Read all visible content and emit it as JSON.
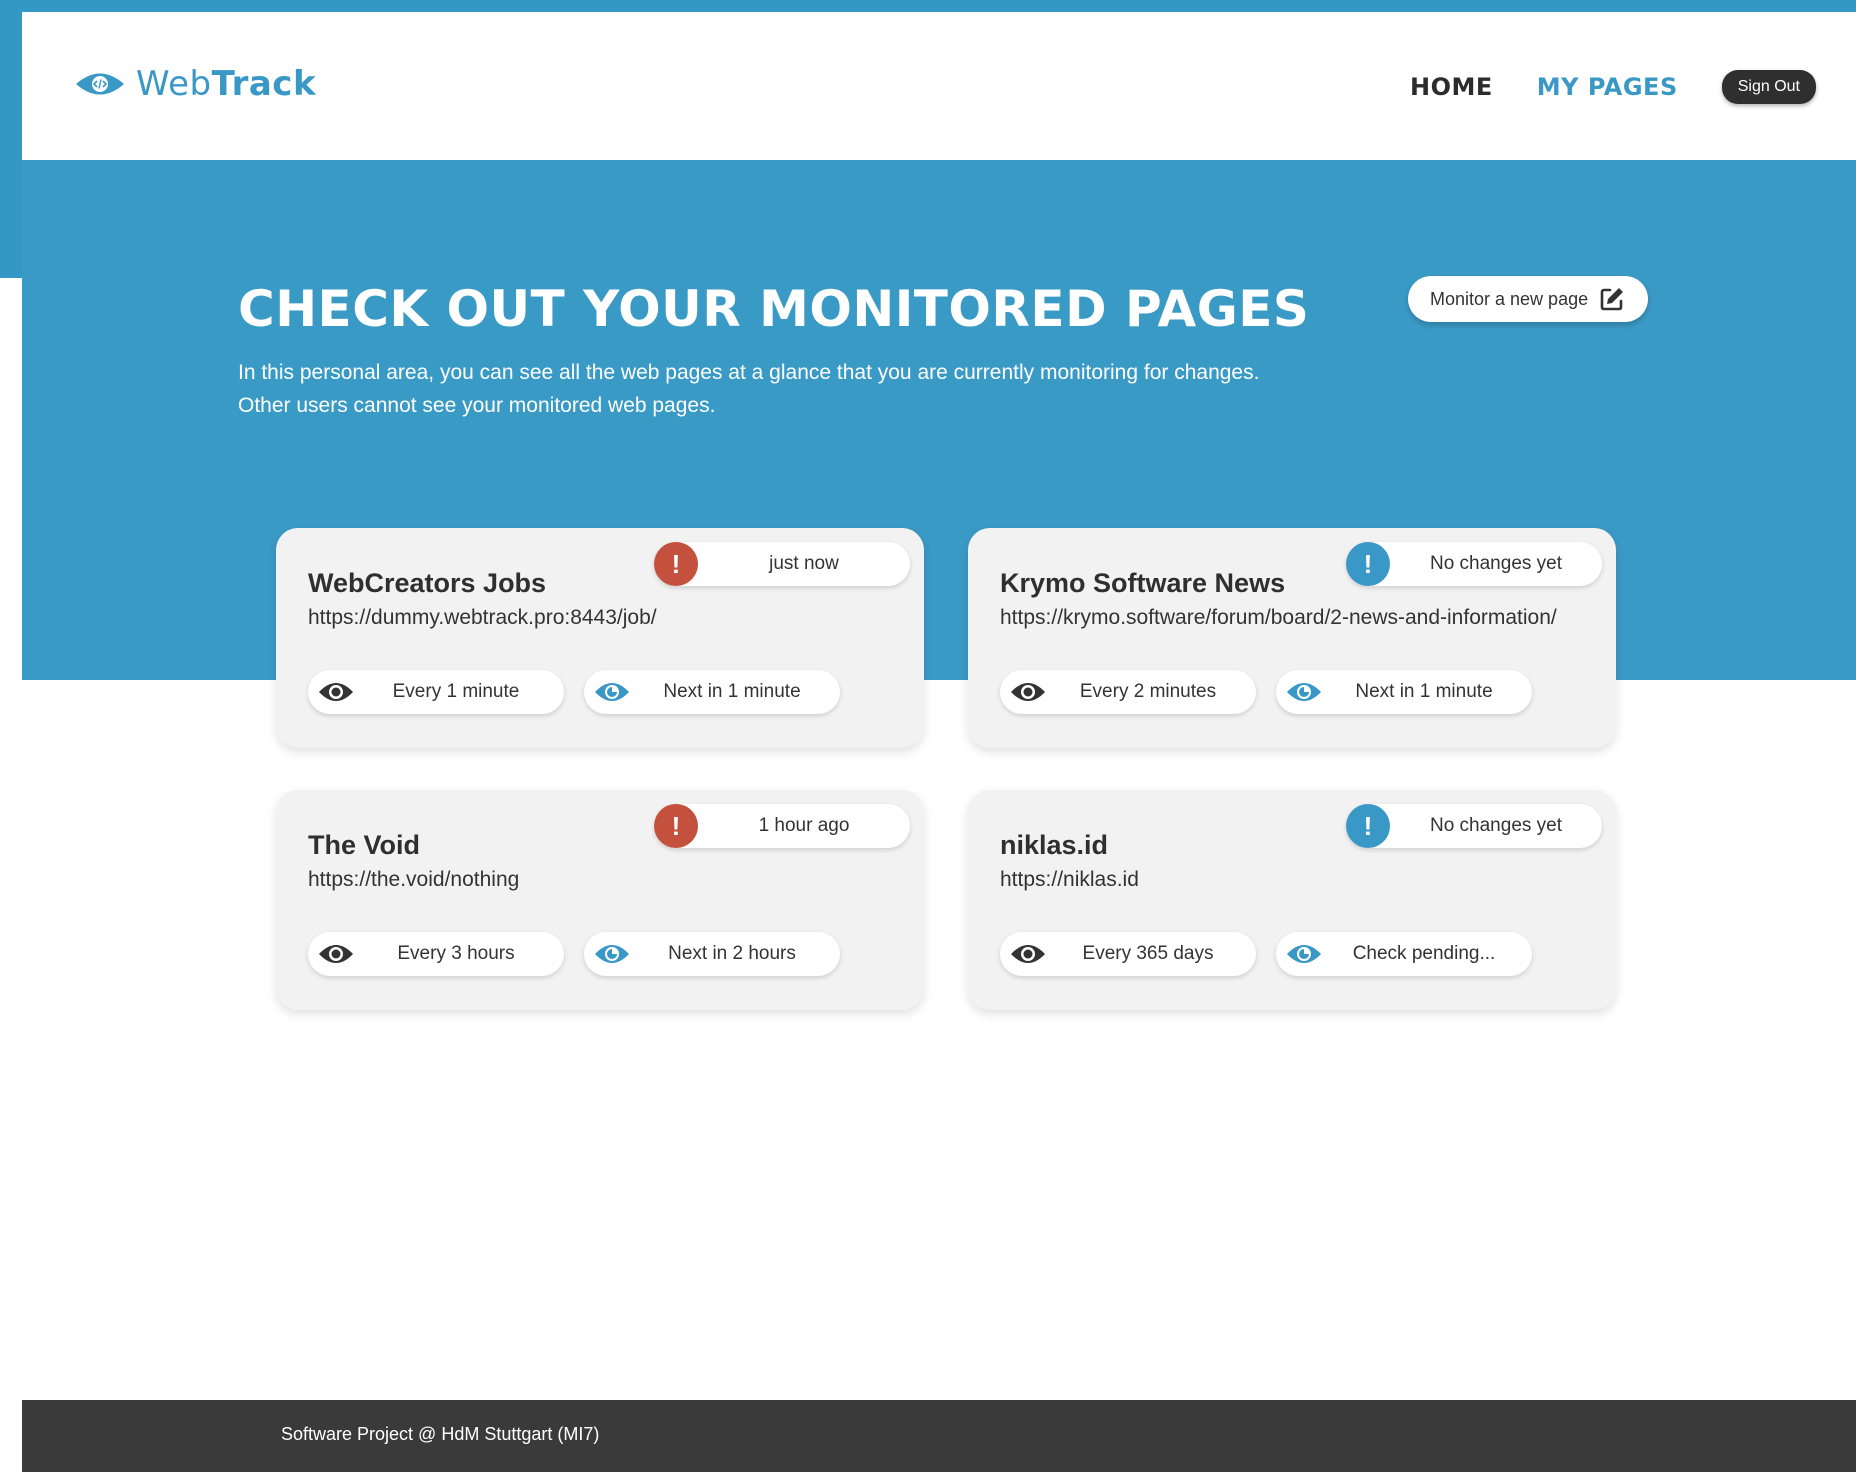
{
  "colors": {
    "brand": "#3a9ac6",
    "alert": "#c4503e",
    "footer": "#3a3a3a"
  },
  "logo": {
    "light": "Web",
    "bold": "Track"
  },
  "nav": {
    "home": "HOME",
    "my_pages": "MY PAGES",
    "sign_out": "Sign Out"
  },
  "hero": {
    "title": "CHECK OUT YOUR MONITORED PAGES",
    "desc_line1": "In this personal area, you can see all the web pages at a glance that you are currently monitoring for changes.",
    "desc_line2": "Other users cannot see your monitored web pages.",
    "monitor_button": "Monitor a new page"
  },
  "cards": [
    {
      "title": "WebCreators Jobs",
      "url": "https://dummy.webtrack.pro:8443/job/",
      "status": "just now",
      "status_icon": "alert-red-icon",
      "interval": "Every 1 minute",
      "next": "Next in 1 minute"
    },
    {
      "title": "Krymo Software News",
      "url": "https://krymo.software/forum/board/2-news-and-information/",
      "status": "No changes yet",
      "status_icon": "alert-blue-icon",
      "interval": "Every 2 minutes",
      "next": "Next in 1 minute"
    },
    {
      "title": "The Void",
      "url": "https://the.void/nothing",
      "status": "1 hour ago",
      "status_icon": "alert-red-icon",
      "interval": "Every 3 hours",
      "next": "Next in 2 hours"
    },
    {
      "title": "niklas.id",
      "url": "https://niklas.id",
      "status": "No changes yet",
      "status_icon": "alert-blue-icon",
      "interval": "Every 365 days",
      "next": "Check pending..."
    }
  ],
  "footer": {
    "text": "Software Project @ HdM Stuttgart (MI7)"
  }
}
